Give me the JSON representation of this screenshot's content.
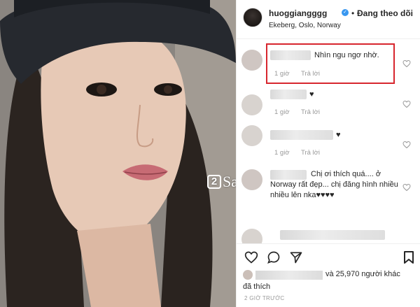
{
  "post": {
    "username": "huoggiangggg",
    "verified_glyph": "✓",
    "separator": "•",
    "follow_status": "Đang theo dõi",
    "location": "Ekeberg, Oslo, Norway"
  },
  "watermark": {
    "number": "2",
    "text": "Sao"
  },
  "comments": [
    {
      "text": "Nhìn ngu ngơ nhờ.",
      "time": "1 giờ",
      "reply": "Trả lời"
    },
    {
      "text": "♥",
      "time": "1 giờ",
      "reply": "Trả lời"
    },
    {
      "text": "♥",
      "time": "1 giờ",
      "reply": "Trả lời"
    },
    {
      "text": "Chị ơi thích quá.... ở Norway rất đẹp... chị đăng hình nhiều nhiều lên nka♥♥♥♥",
      "time": "1 giờ",
      "reply": "Trả lời"
    }
  ],
  "footer": {
    "likes_suffix": "và 25,970 người khác",
    "liked_label": "đã thích",
    "timestamp": "2 GIỜ TRƯỚC"
  },
  "icons": {
    "like": "heart-outline-icon",
    "comment": "comment-bubble-icon",
    "share": "share-arrow-icon",
    "save": "bookmark-icon"
  },
  "colors": {
    "highlight": "#d7262e",
    "verified": "#3897f0",
    "meta": "#999999"
  }
}
